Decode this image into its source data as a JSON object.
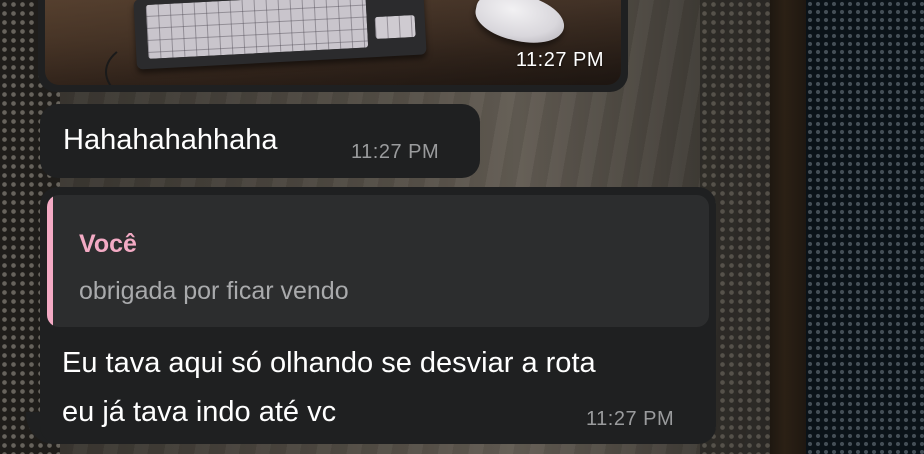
{
  "theme": {
    "bubble_color": "#1f2021",
    "quote_bg_color": "#2c2d2e",
    "quote_accent_color": "#f3aac4",
    "text_color": "#ffffff",
    "timestamp_color": "#9a9b9d"
  },
  "messages": [
    {
      "type": "photo",
      "time": "11:27 PM"
    },
    {
      "type": "text",
      "text": "Hahahahahhaha",
      "time": "11:27 PM"
    },
    {
      "type": "reply",
      "quoted": {
        "author": "Você",
        "text": "obrigada por ficar vendo"
      },
      "text": "Eu tava aqui só olhando se desviar a rota eu já tava indo até vc",
      "time": "11:27 PM"
    }
  ]
}
